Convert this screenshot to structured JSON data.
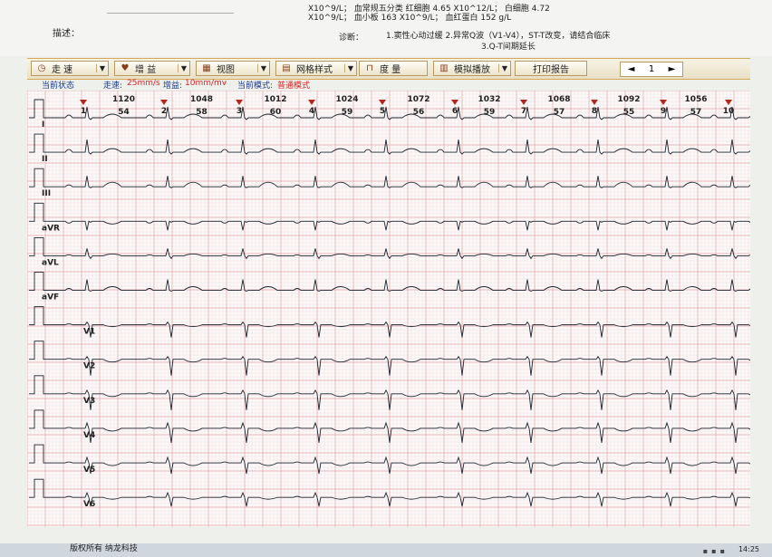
{
  "report": {
    "lab_line1": "X10^9/L；  血常规五分类  红细胞 4.65 X10^12/L；  白细胞 4.72",
    "lab_line2": "X10^9/L；  血小板 163 X10^9/L；  血红蛋白 152 g/L",
    "description_label": "描述：",
    "diagnosis_label": "诊断：",
    "diagnosis_line1": "1.窦性心动过缓 2.异常Q波（V1-V4），ST-T改变，请结合临床",
    "diagnosis_line2": "3.Q-T间期延长"
  },
  "toolbar": {
    "speed_label": "走 速",
    "gain_label": "增 益",
    "view_label": "视图",
    "grid_label": "网格样式",
    "measure_label": "度 量",
    "playback_label": "模拟播放",
    "print_label": "打印报告",
    "page_number": "1",
    "prev_label": "◄",
    "next_label": "►"
  },
  "status": {
    "current_status_label": "当前状态",
    "speed_text": "走速:",
    "speed_value": "25mm/s",
    "gain_text": "增益:",
    "gain_value": "10mm/mv",
    "mode_text": "当前模式:",
    "mode_value": "普通模式"
  },
  "beats": [
    {
      "n": "1",
      "rr": "1120",
      "hr": "54"
    },
    {
      "n": "2",
      "rr": "1048",
      "hr": "58"
    },
    {
      "n": "3",
      "rr": "1012",
      "hr": "60"
    },
    {
      "n": "4",
      "rr": "1024",
      "hr": "59"
    },
    {
      "n": "5",
      "rr": "1072",
      "hr": "56"
    },
    {
      "n": "6",
      "rr": "1032",
      "hr": "59"
    },
    {
      "n": "7",
      "rr": "1068",
      "hr": "57"
    },
    {
      "n": "8",
      "rr": "1092",
      "hr": "55"
    },
    {
      "n": "9",
      "rr": "1056",
      "hr": "57"
    },
    {
      "n": "10",
      "rr": "",
      "hr": ""
    }
  ],
  "leads": [
    "I",
    "II",
    "III",
    "aVR",
    "aVL",
    "aVF",
    "V1",
    "V2",
    "V3",
    "V4",
    "V5",
    "V6"
  ],
  "colors": {
    "grid_major": "#e7a7a7",
    "grid_minor": "#f3d3d3",
    "trace": "#1e2530",
    "marker": "#b0281e",
    "status_blue": "#1c3a8a"
  },
  "footer": {
    "copyright": "版权所有  纳龙科技",
    "clock": "14:25"
  }
}
